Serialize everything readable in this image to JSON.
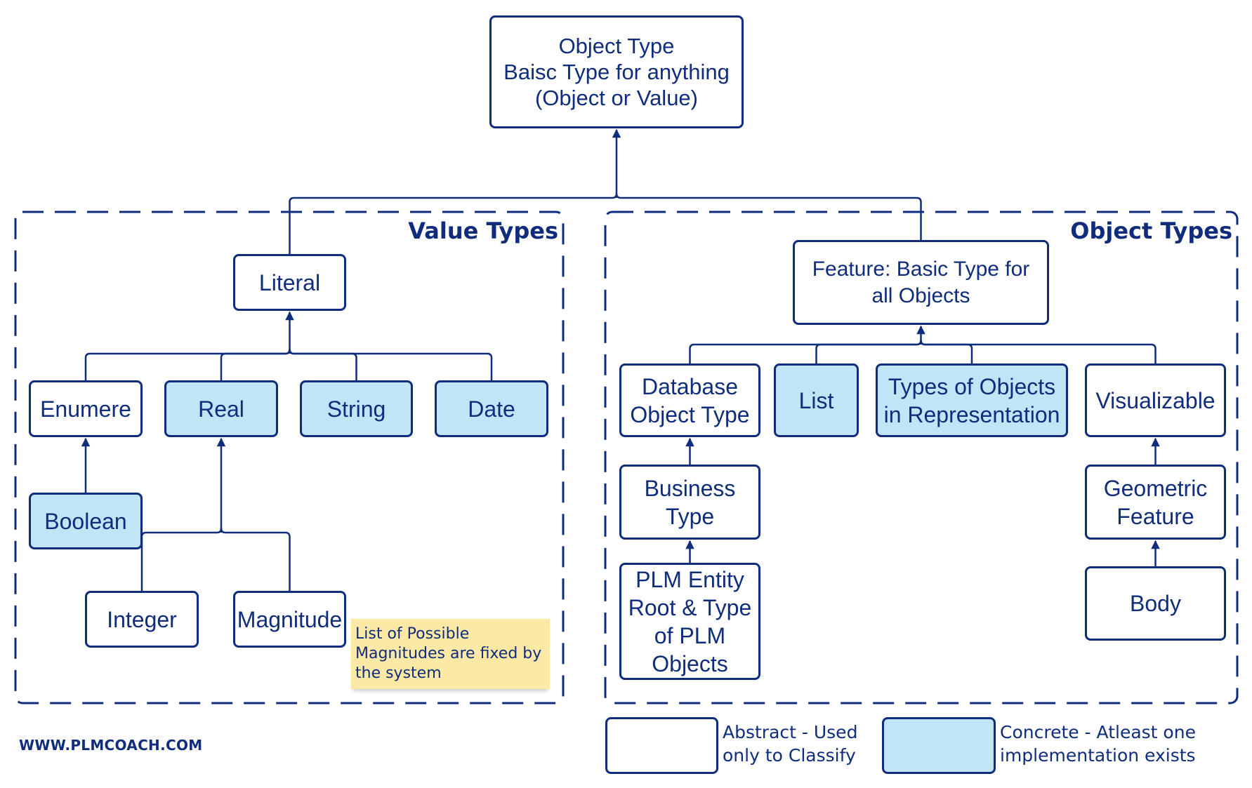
{
  "colors": {
    "stroke": "#0f2d7c",
    "concrete_fill": "#c2e4f7",
    "abstract_fill": "#ffffff",
    "note_fill": "#fde9a6"
  },
  "nodes": {
    "root": {
      "label": "Object Type\nBaisc Type for anything\n(Object or Value)",
      "kind": "abstract"
    },
    "literal": {
      "label": "Literal",
      "kind": "abstract"
    },
    "enumere": {
      "label": "Enumere",
      "kind": "abstract"
    },
    "real": {
      "label": "Real",
      "kind": "concrete"
    },
    "string": {
      "label": "String",
      "kind": "concrete"
    },
    "date": {
      "label": "Date",
      "kind": "concrete"
    },
    "boolean": {
      "label": "Boolean",
      "kind": "concrete"
    },
    "integer": {
      "label": "Integer",
      "kind": "abstract"
    },
    "magnitude": {
      "label": "Magnitude",
      "kind": "abstract"
    },
    "feature": {
      "label": "Feature: Basic Type for\nall Objects",
      "kind": "abstract"
    },
    "database_object_type": {
      "label": "Database\nObject Type",
      "kind": "abstract"
    },
    "list": {
      "label": "List",
      "kind": "concrete"
    },
    "types_in_representation": {
      "label": "Types of Objects\nin Representation",
      "kind": "concrete"
    },
    "visualizable": {
      "label": "Visualizable",
      "kind": "abstract"
    },
    "business_type": {
      "label": "Business\nType",
      "kind": "abstract"
    },
    "plm_entity": {
      "label": "PLM Entity\nRoot & Type\nof PLM\nObjects",
      "kind": "abstract"
    },
    "geometric_feature": {
      "label": "Geometric\nFeature",
      "kind": "abstract"
    },
    "body": {
      "label": "Body",
      "kind": "abstract"
    }
  },
  "edges": [
    {
      "from": "literal",
      "to": "root"
    },
    {
      "from": "feature",
      "to": "root"
    },
    {
      "from": "enumere",
      "to": "literal"
    },
    {
      "from": "real",
      "to": "literal"
    },
    {
      "from": "string",
      "to": "literal"
    },
    {
      "from": "date",
      "to": "literal"
    },
    {
      "from": "boolean",
      "to": "enumere"
    },
    {
      "from": "integer",
      "to": "real"
    },
    {
      "from": "magnitude",
      "to": "real"
    },
    {
      "from": "database_object_type",
      "to": "feature"
    },
    {
      "from": "list",
      "to": "feature"
    },
    {
      "from": "types_in_representation",
      "to": "feature"
    },
    {
      "from": "visualizable",
      "to": "feature"
    },
    {
      "from": "business_type",
      "to": "database_object_type"
    },
    {
      "from": "plm_entity",
      "to": "business_type"
    },
    {
      "from": "geometric_feature",
      "to": "visualizable"
    },
    {
      "from": "body",
      "to": "geometric_feature"
    }
  ],
  "groups": {
    "value_types": {
      "title": "Value Types"
    },
    "object_types": {
      "title": "Object Types"
    }
  },
  "note": {
    "text": "List of Possible Magnitudes are fixed by the system"
  },
  "legend": {
    "abstract": "Abstract - Used\nonly to Classify",
    "concrete": "Concrete - Atleast one\nimplementation exists"
  },
  "watermark": "WWW.PLMCOACH.COM"
}
